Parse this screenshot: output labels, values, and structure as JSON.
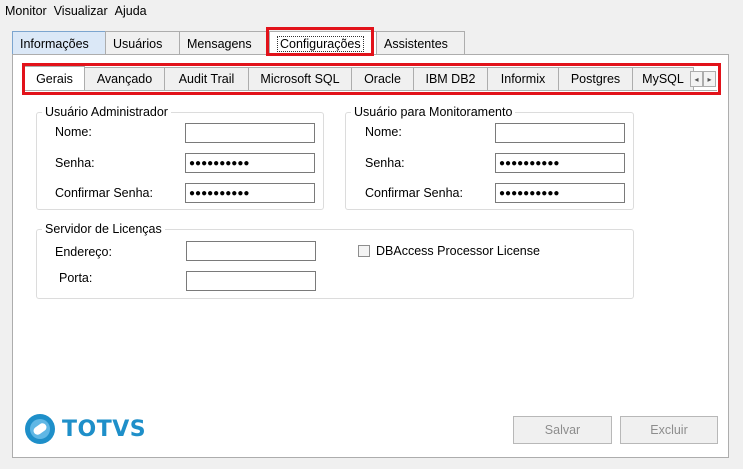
{
  "menu": [
    "Monitor",
    "Visualizar",
    "Ajuda"
  ],
  "main_tabs": [
    "Informações",
    "Usuários",
    "Mensagens",
    "Configurações",
    "Assistentes"
  ],
  "config_tabs": [
    "Gerais",
    "Avançado",
    "Audit Trail",
    "Microsoft SQL",
    "Oracle",
    "IBM DB2",
    "Informix",
    "Postgres",
    "MySQL"
  ],
  "scroll_arrows": [
    "◂",
    "▸"
  ],
  "admin_group": {
    "title": "Usuário Administrador",
    "name_label": "Nome:",
    "password_label": "Senha:",
    "confirm_label": "Confirmar Senha:",
    "name_value": "",
    "password_value": "●●●●●●●●●●",
    "confirm_value": "●●●●●●●●●●"
  },
  "monitor_group": {
    "title": "Usuário para Monitoramento",
    "name_label": "Nome:",
    "password_label": "Senha:",
    "confirm_label": "Confirmar Senha:",
    "name_value": "",
    "password_value": "●●●●●●●●●●",
    "confirm_value": "●●●●●●●●●●"
  },
  "license_group": {
    "title": "Servidor de Licenças",
    "address_label": "Endereço:",
    "port_label": "Porta:",
    "address_value": "",
    "port_value": "",
    "dbaccess_label": "DBAccess Processor License",
    "dbaccess_checked": false
  },
  "brand": {
    "name": "TOTVS",
    "color": "#1e8fc9"
  },
  "buttons": {
    "save": "Salvar",
    "delete": "Excluir"
  },
  "highlight_color": "#e2121a"
}
